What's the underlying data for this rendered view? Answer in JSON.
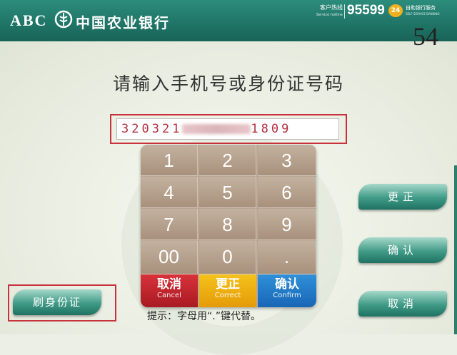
{
  "header": {
    "logo_abc": "ABC",
    "logo_cn": "中国农业银行",
    "hotline_label_cn": "客户热线",
    "hotline_label_en": "Service hotline",
    "hotline_number": "95599",
    "badge": "24",
    "service_cn": "自助银行服务",
    "service_en": "SELF-SERVICE BANKING"
  },
  "countdown": "54",
  "prompt": "请输入手机号或身份证号码",
  "input": {
    "prefix": "320321",
    "suffix": "1809"
  },
  "keypad": {
    "keys": [
      "1",
      "2",
      "3",
      "4",
      "5",
      "6",
      "7",
      "8",
      "9",
      "00",
      "0",
      "."
    ],
    "cancel": {
      "cn": "取消",
      "en": "Cancel"
    },
    "correct": {
      "cn": "更正",
      "en": "Correct"
    },
    "confirm": {
      "cn": "确认",
      "en": "Confirm"
    }
  },
  "hint": "提示：字母用“.”键代替。",
  "side_buttons": {
    "correct": "更正",
    "confirm": "确认",
    "cancel": "取消",
    "swipe_id": "刷身份证"
  },
  "colors": {
    "header": "#1f7466",
    "highlight": "#c8323c",
    "cancel": "#c2262e",
    "correct": "#f0b414",
    "confirm": "#2480cc"
  }
}
